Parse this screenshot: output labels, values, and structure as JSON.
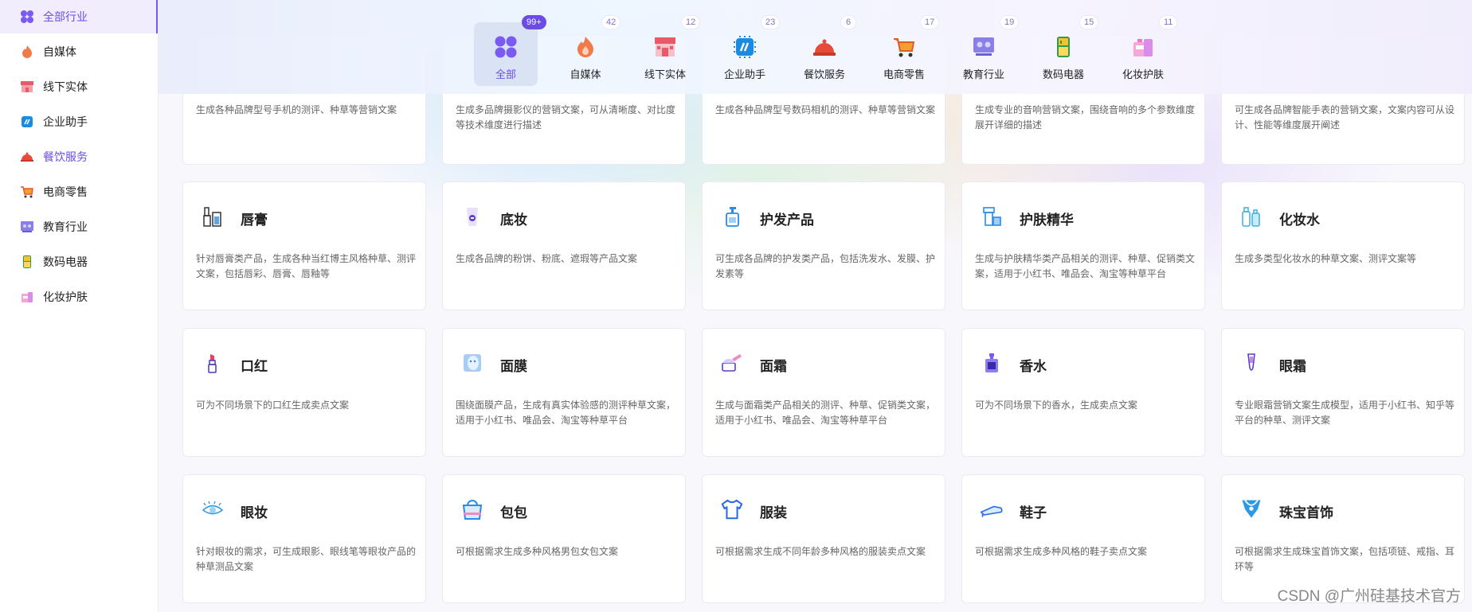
{
  "sidebar": {
    "items": [
      {
        "label": "全部行业",
        "icon": "grid-icon"
      },
      {
        "label": "自媒体",
        "icon": "flame-icon"
      },
      {
        "label": "线下实体",
        "icon": "store-icon"
      },
      {
        "label": "企业助手",
        "icon": "chip-icon"
      },
      {
        "label": "餐饮服务",
        "icon": "cloche-icon"
      },
      {
        "label": "电商零售",
        "icon": "cart-icon"
      },
      {
        "label": "教育行业",
        "icon": "classroom-icon"
      },
      {
        "label": "数码电器",
        "icon": "fridge-icon"
      },
      {
        "label": "化妆护肤",
        "icon": "cosmetics-icon"
      }
    ]
  },
  "categories": [
    {
      "label": "全部",
      "count": "99+",
      "icon": "grid-icon"
    },
    {
      "label": "自媒体",
      "count": "42",
      "icon": "flame-icon"
    },
    {
      "label": "线下实体",
      "count": "12",
      "icon": "store-icon"
    },
    {
      "label": "企业助手",
      "count": "23",
      "icon": "chip-icon"
    },
    {
      "label": "餐饮服务",
      "count": "6",
      "icon": "cloche-icon"
    },
    {
      "label": "电商零售",
      "count": "17",
      "icon": "cart-icon"
    },
    {
      "label": "教育行业",
      "count": "19",
      "icon": "classroom-icon"
    },
    {
      "label": "数码电器",
      "count": "15",
      "icon": "fridge-icon"
    },
    {
      "label": "化妆护肤",
      "count": "11",
      "icon": "cosmetics-icon"
    }
  ],
  "partial_row": [
    {
      "desc": "生成各种品牌型号手机的测评、种草等营销文案"
    },
    {
      "desc": "生成多品牌摄影仪的营销文案，可从清晰度、对比度等技术维度进行描述"
    },
    {
      "desc": "生成各种品牌型号数码相机的测评、种草等营销文案"
    },
    {
      "desc": "生成专业的音响营销文案，围绕音响的多个参数维度展开详细的描述"
    },
    {
      "desc": "可生成各品牌智能手表的营销文案，文案内容可从设计、性能等维度展开阐述"
    }
  ],
  "cards": [
    {
      "title": "唇膏",
      "desc": "针对唇膏类产品，生成各种当红博主风格种草、测评文案，包括唇彩、唇膏、唇釉等",
      "icon": "lipgloss-icon"
    },
    {
      "title": "底妆",
      "desc": "生成各品牌的粉饼、粉底、遮瑕等产品文案",
      "icon": "foundation-icon"
    },
    {
      "title": "护发产品",
      "desc": "可生成各品牌的护发类产品，包括洗发水、发膜、护发素等",
      "icon": "pump-bottle-icon"
    },
    {
      "title": "护肤精华",
      "desc": "生成与护肤精华类产品相关的测评、种草、促销类文案，适用于小红书、唯品会、淘宝等种草平台",
      "icon": "serum-icon"
    },
    {
      "title": "化妆水",
      "desc": "生成多类型化妆水的种草文案、测评文案等",
      "icon": "toner-icon"
    },
    {
      "title": "口红",
      "desc": "可为不同场景下的口红生成卖点文案",
      "icon": "lipstick-icon"
    },
    {
      "title": "面膜",
      "desc": "围绕面膜产品，生成有真实体验感的测评种草文案，适用于小红书、唯品会、淘宝等种草平台",
      "icon": "face-mask-icon"
    },
    {
      "title": "面霜",
      "desc": "生成与面霜类产品相关的测评、种草、促销类文案，适用于小红书、唯品会、淘宝等种草平台",
      "icon": "cream-jar-icon"
    },
    {
      "title": "香水",
      "desc": "可为不同场景下的香水，生成卖点文案",
      "icon": "perfume-icon"
    },
    {
      "title": "眼霜",
      "desc": "专业眼霜营销文案生成模型，适用于小红书、知乎等平台的种草、测评文案",
      "icon": "eye-cream-icon"
    },
    {
      "title": "眼妆",
      "desc": "针对眼妆的需求，可生成眼影、眼线笔等眼妆产品的种草测品文案",
      "icon": "eye-icon"
    },
    {
      "title": "包包",
      "desc": "可根据需求生成多种风格男包女包文案",
      "icon": "handbag-icon"
    },
    {
      "title": "服装",
      "desc": "可根据需求生成不同年龄多种风格的服装卖点文案",
      "icon": "shirt-icon"
    },
    {
      "title": "鞋子",
      "desc": "可根据需求生成多种风格的鞋子卖点文案",
      "icon": "shoe-icon"
    },
    {
      "title": "珠宝首饰",
      "desc": "可根据需求生成珠宝首饰文案，包括项链、戒指、耳环等",
      "icon": "necklace-icon"
    }
  ],
  "watermark": "CSDN @广州硅基技术官方",
  "colors": {
    "accent": "#6b4de6",
    "active_bg": "#f1edfc"
  }
}
